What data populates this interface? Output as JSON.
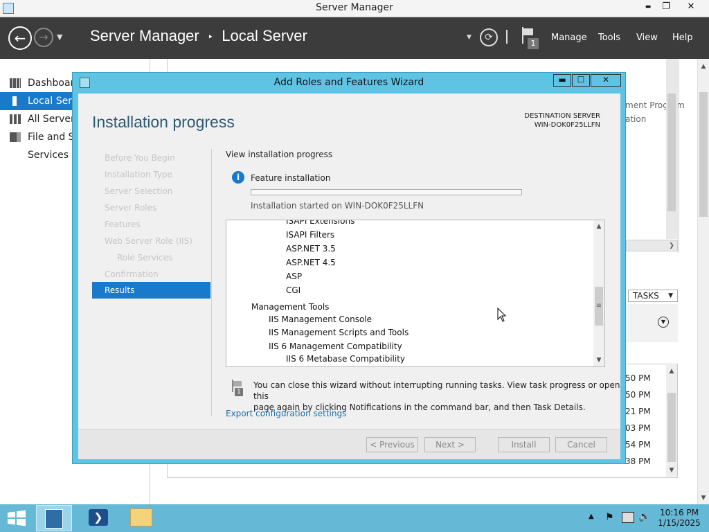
{
  "window": {
    "title": "Server Manager",
    "minimize": "▬",
    "restore": "❐",
    "close": "✕"
  },
  "header": {
    "breadcrumb_app": "Server Manager",
    "breadcrumb_sep": "‣",
    "breadcrumb_page": "Local Server",
    "notification_count": "1",
    "menus": [
      "Manage",
      "Tools",
      "View",
      "Help"
    ]
  },
  "sidebar": {
    "items": [
      {
        "label": "Dashboard",
        "icon": "dashboard-icon"
      },
      {
        "label": "Local Server",
        "icon": "local-server-icon",
        "selected": true
      },
      {
        "label": "All Servers",
        "icon": "all-servers-icon"
      },
      {
        "label": "File and Storage Services",
        "icon": "storage-icon"
      }
    ]
  },
  "background": {
    "right_text": [
      "ment Program",
      "ation"
    ],
    "tasks_label": "TASKS",
    "times": [
      "50 PM",
      "50 PM",
      "21 PM",
      "03 PM",
      "54 PM",
      "38 PM"
    ]
  },
  "wizard": {
    "title": "Add Roles and Features Wizard",
    "page_title": "Installation progress",
    "destination_label": "DESTINATION SERVER",
    "destination_server": "WIN-DOK0F25LLFN",
    "steps": [
      {
        "label": "Before You Begin",
        "indent": false
      },
      {
        "label": "Installation Type",
        "indent": false
      },
      {
        "label": "Server Selection",
        "indent": false
      },
      {
        "label": "Server Roles",
        "indent": false
      },
      {
        "label": "Features",
        "indent": false
      },
      {
        "label": "Web Server Role (IIS)",
        "indent": false
      },
      {
        "label": "Role Services",
        "indent": true
      },
      {
        "label": "Confirmation",
        "indent": false
      },
      {
        "label": "Results",
        "indent": false,
        "active": true
      }
    ],
    "section_label": "View installation progress",
    "feature_label": "Feature installation",
    "progress": 0,
    "started_text": "Installation started on WIN-DOK0F25LLFN",
    "tree": [
      {
        "label": "ISAPI Extensions",
        "level": 3,
        "bold": false
      },
      {
        "label": "ISAPI Filters",
        "level": 3,
        "bold": false
      },
      {
        "label": "ASP.NET 3.5",
        "level": 3,
        "bold": false
      },
      {
        "label": "ASP.NET 4.5",
        "level": 3,
        "bold": false
      },
      {
        "label": "ASP",
        "level": 3,
        "bold": false
      },
      {
        "label": "CGI",
        "level": 3,
        "bold": false
      },
      {
        "label": "Management Tools",
        "level": 1,
        "bold": false
      },
      {
        "label": "IIS Management Console",
        "level": 2,
        "bold": false
      },
      {
        "label": "IIS Management Scripts and Tools",
        "level": 2,
        "bold": false
      },
      {
        "label": "IIS 6 Management Compatibility",
        "level": 2,
        "bold": false
      },
      {
        "label": "IIS 6 Metabase Compatibility",
        "level": 3,
        "bold": false
      }
    ],
    "info_text_1": "You can close this wizard without interrupting running tasks. View task progress or open this",
    "info_text_2": "page again by clicking Notifications in the command bar, and then Task Details.",
    "export_link": "Export configuration settings",
    "buttons": {
      "previous": "< Previous",
      "next": "Next >",
      "install": "Install",
      "cancel": "Cancel"
    }
  },
  "taskbar": {
    "time": "10:16 PM",
    "date": "1/15/2025"
  }
}
